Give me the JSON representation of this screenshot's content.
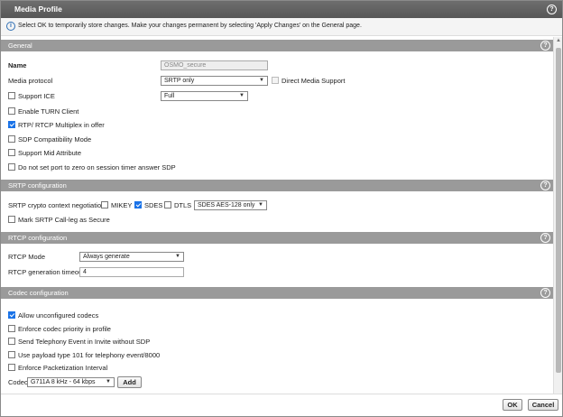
{
  "window": {
    "title": "Media Profile",
    "help_label": "?"
  },
  "info": {
    "icon": "info-icon",
    "text": "Select OK to temporarily store changes. Make your changes permanent by selecting 'Apply Changes' on the General page."
  },
  "general": {
    "header": "General",
    "name_label": "Name",
    "name_value": "OSMO_secure",
    "media_protocol_label": "Media protocol",
    "media_protocol_value": "SRTP only",
    "direct_media_label": "Direct Media Support",
    "support_ice_label": "Support ICE",
    "ice_mode_value": "Full",
    "enable_turn_label": "Enable TURN Client",
    "rtp_multiplex_label": "RTP/ RTCP Multiplex in offer",
    "sdp_compat_label": "SDP Compatibility Mode",
    "support_mid_label": "Support Mid Attribute",
    "no_port_zero_label": "Do not set port to zero on session timer answer SDP"
  },
  "srtp": {
    "header": "SRTP configuration",
    "crypto_label": "SRTP crypto context negotiation",
    "mikey_label": "MIKEY",
    "sdes_label": "SDES",
    "dtls_label": "DTLS",
    "cipher_value": "SDES AES-128 only",
    "mark_secure_label": "Mark SRTP Call-leg as Secure"
  },
  "rtcp": {
    "header": "RTCP configuration",
    "mode_label": "RTCP Mode",
    "mode_value": "Always generate",
    "timeout_label": "RTCP generation timeout",
    "timeout_value": "4"
  },
  "codec": {
    "header": "Codec configuration",
    "allow_unconfigured_label": "Allow unconfigured codecs",
    "enforce_priority_label": "Enforce codec priority in profile",
    "send_telephony_label": "Send Telephony Event in Invite without SDP",
    "payload_101_label": "Use payload type 101 for telephony event/8000",
    "enforce_packetization_label": "Enforce Packetization Interval",
    "codec_label": "Codec",
    "codec_value": "G711A 8 kHz - 64 kbps",
    "add_label": "Add"
  },
  "footer": {
    "ok_label": "OK",
    "cancel_label": "Cancel"
  }
}
